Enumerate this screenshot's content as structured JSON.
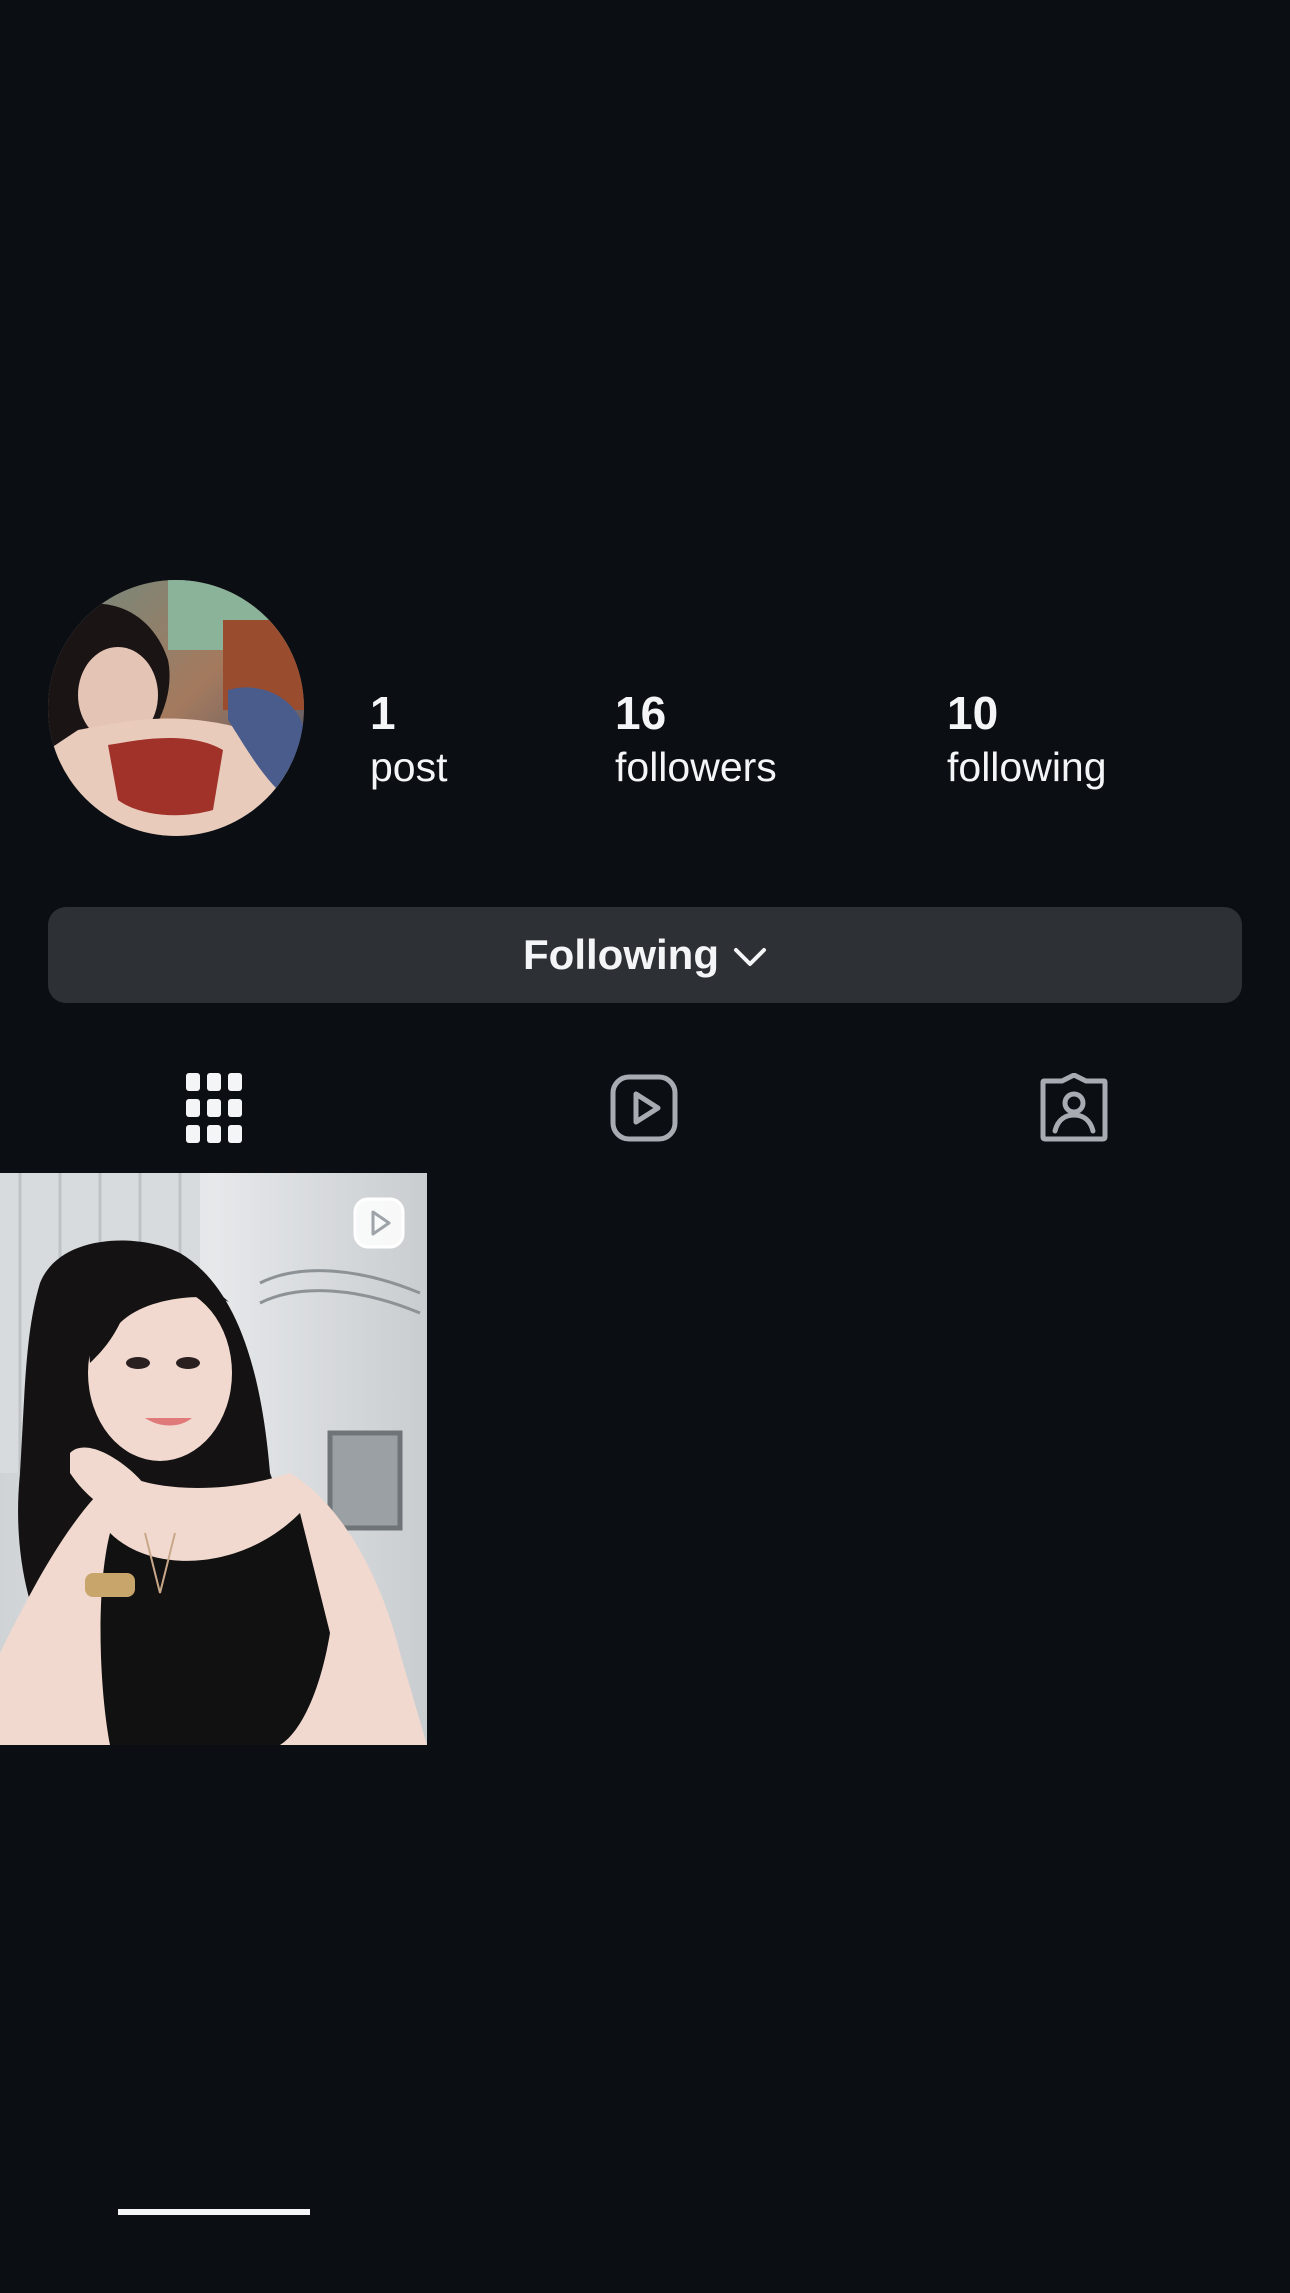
{
  "profile": {
    "avatar_icon": "profile-avatar-photo",
    "stats": [
      {
        "value": "1",
        "label": "post"
      },
      {
        "value": "16",
        "label": "followers"
      },
      {
        "value": "10",
        "label": "following"
      }
    ],
    "follow_button_label": "Following",
    "follow_button_icon": "chevron-down-icon"
  },
  "tabs": [
    {
      "name": "posts",
      "icon": "grid-icon",
      "active": true
    },
    {
      "name": "reels",
      "icon": "reels-icon",
      "active": false
    },
    {
      "name": "tagged",
      "icon": "tagged-person-icon",
      "active": false
    }
  ],
  "posts": [
    {
      "type": "reel",
      "badge_icon": "reel-play-icon"
    }
  ],
  "colors": {
    "background": "#0b0f14",
    "button": "#2d3034",
    "text": "#f3f5f7",
    "icon_inactive": "#a8acb2"
  }
}
